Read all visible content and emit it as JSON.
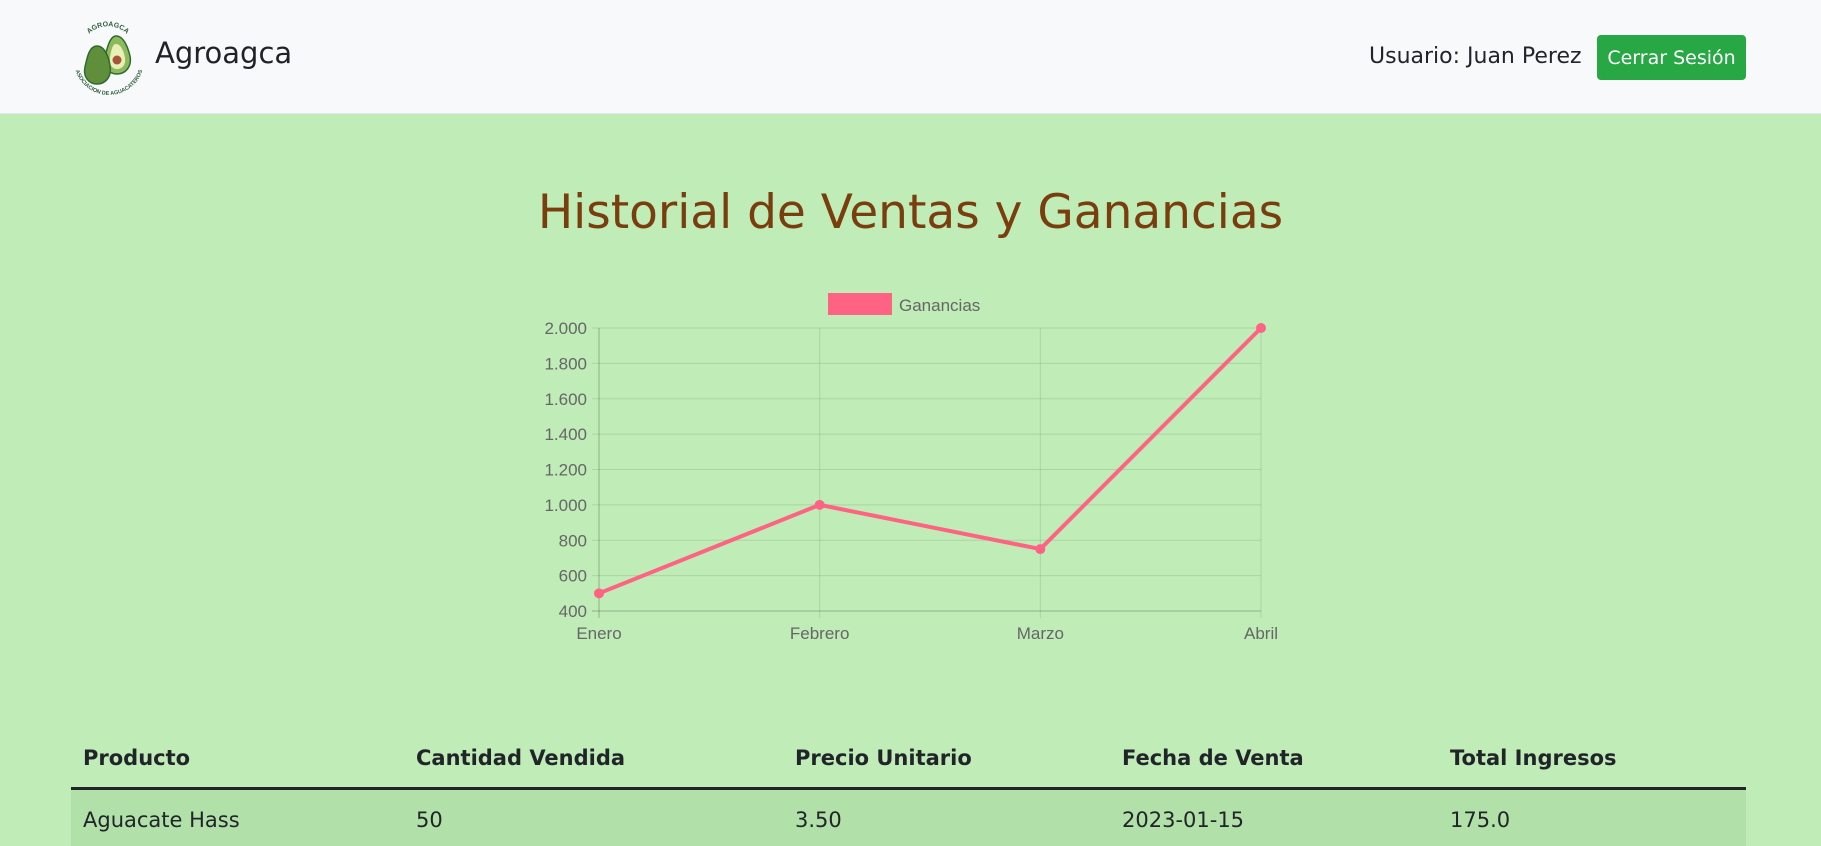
{
  "header": {
    "brand_name": "Agroagca",
    "logo_text_top": "AGROAGCA",
    "logo_text_bottom": "ASOCIACION DE AGUACATEROS",
    "user_label": "Usuario: Juan Perez",
    "logout_label": "Cerrar Sesión"
  },
  "page": {
    "title": "Historial de Ventas y Ganancias"
  },
  "chart_data": {
    "type": "line",
    "categories": [
      "Enero",
      "Febrero",
      "Marzo",
      "Abril"
    ],
    "series": [
      {
        "name": "Ganancias",
        "values": [
          500,
          1000,
          750,
          2000
        ],
        "color": "#ff6384"
      }
    ],
    "ylim": [
      400,
      2000
    ],
    "yticks": [
      400,
      600,
      800,
      1000,
      1200,
      1400,
      1600,
      1800,
      2000
    ],
    "ytick_labels": [
      "400",
      "600",
      "800",
      "1.000",
      "1.200",
      "1.400",
      "1.600",
      "1.800",
      "2.000"
    ],
    "grid": true,
    "legend_position": "top"
  },
  "table": {
    "headers": [
      "Producto",
      "Cantidad Vendida",
      "Precio Unitario",
      "Fecha de Venta",
      "Total Ingresos"
    ],
    "rows": [
      [
        "Aguacate Hass",
        "50",
        "3.50",
        "2023-01-15",
        "175.0"
      ]
    ]
  },
  "colors": {
    "page_background": "#bfecb7",
    "navbar_background": "#f8f9fb",
    "title": "#7a3d0d",
    "button": "#28a745",
    "row_background": "#b1e1a8"
  }
}
